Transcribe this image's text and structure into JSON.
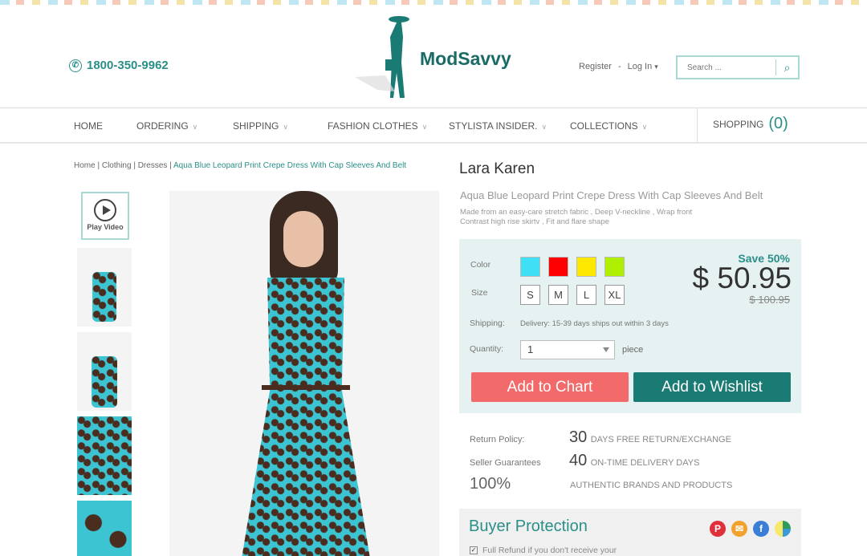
{
  "header": {
    "phone": "1800-350-9962",
    "brand": "ModSavvy",
    "register": "Register",
    "separator": "-",
    "login": "Log In",
    "search_placeholder": "Search ..."
  },
  "nav": {
    "items": [
      {
        "label": "HOME"
      },
      {
        "label": "ORDERING"
      },
      {
        "label": "SHIPPING"
      },
      {
        "label": "FASHION CLOTHES"
      },
      {
        "label": "STYLISTA INSIDER."
      },
      {
        "label": "COLLECTIONS"
      }
    ],
    "shopping_label": "SHOPPING",
    "cart_count": "(0)"
  },
  "breadcrumb": [
    "Home",
    "Clothing",
    "Dresses",
    "Aqua Blue Leopard Print Crepe Dress With Cap Sleeves And Belt"
  ],
  "gallery": {
    "play_video": "Play Video"
  },
  "product": {
    "brand": "Lara Karen",
    "name": "Aqua Blue Leopard Print Crepe Dress With Cap Sleeves And Belt",
    "desc_line1": "Made from an easy-care stretch fabric ,  Deep V-neckline ,  Wrap front",
    "desc_line2": "Contrast high rise skirtv ,  Fit and flare shape",
    "color_label": "Color",
    "colors": [
      "#3fe0f5",
      "#ff0000",
      "#ffe800",
      "#aef000"
    ],
    "size_label": "Size",
    "sizes": [
      "S",
      "M",
      "L",
      "XL"
    ],
    "shipping_label": "Shipping:",
    "shipping_value": "Delivery: 15-39 days ships out within 3 days",
    "quantity_label": "Quantity:",
    "quantity": "1",
    "quantity_unit": "piece",
    "save": "Save 50%",
    "price": "$ 50.95",
    "old_price": "$ 100.95",
    "add_to_cart": "Add to Chart",
    "add_to_wishlist": "Add to Wishlist"
  },
  "policies": {
    "return_label": "Return Policy:",
    "return_num": "30",
    "return_text": "DAYS FREE RETURN/EXCHANGE",
    "seller_label": "Seller Guarantees",
    "seller_num": "40",
    "seller_text": "ON-TIME DELIVERY  DAYS",
    "auth_num": "100%",
    "auth_text": "AUTHENTIC BRANDS AND PRODUCTS"
  },
  "protection": {
    "title": "Buyer Protection",
    "refund": "Full Refund if you don't receive your"
  },
  "colors": {
    "accent": "#2a8f88",
    "cart_button": "#f36a6a",
    "wishlist_button": "#1a7b74"
  }
}
